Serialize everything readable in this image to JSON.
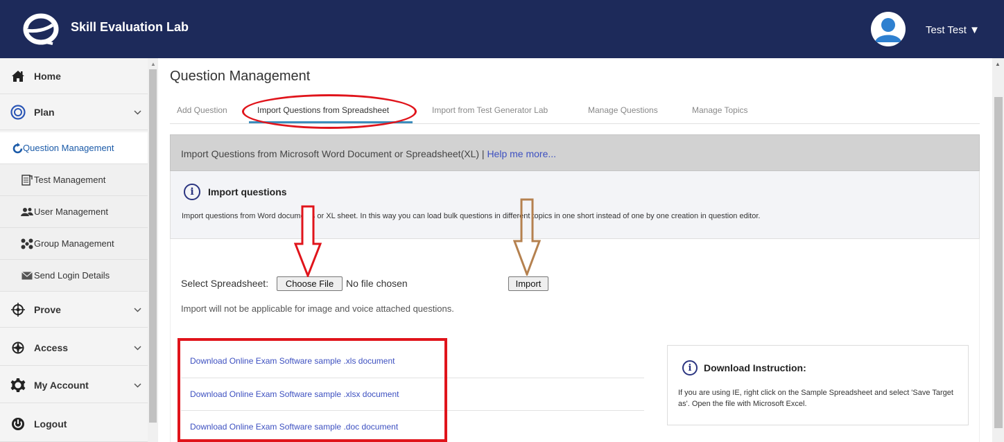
{
  "app": {
    "title": "Skill Evaluation Lab",
    "user_name": "Test Test ▼"
  },
  "sidebar": {
    "items": [
      {
        "label": "Home",
        "icon": "home-icon"
      },
      {
        "label": "Plan",
        "icon": "target-icon"
      },
      {
        "label": "Question Management",
        "icon": "refresh-icon"
      },
      {
        "label": "Test Management",
        "icon": "document-icon"
      },
      {
        "label": "User Management",
        "icon": "users-icon"
      },
      {
        "label": "Group Management",
        "icon": "group-icon"
      },
      {
        "label": "Send Login Details",
        "icon": "envelope-icon"
      },
      {
        "label": "Prove",
        "icon": "crosshair-icon"
      },
      {
        "label": "Access",
        "icon": "compass-icon"
      },
      {
        "label": "My Account",
        "icon": "gear-icon"
      },
      {
        "label": "Logout",
        "icon": "power-icon"
      }
    ]
  },
  "main": {
    "page_title": "Question Management",
    "tabs": [
      {
        "label": "Add Question"
      },
      {
        "label": "Import Questions from Spreadsheet"
      },
      {
        "label": "Import from Test Generator Lab"
      },
      {
        "label": "Manage Questions"
      },
      {
        "label": "Manage Topics"
      }
    ],
    "panel": {
      "heading": "Import Questions from Microsoft Word Document or Spreadsheet(XL) | ",
      "help_link": "Help me more..."
    },
    "info": {
      "title": "Import questions",
      "text": "Import questions from Word documents or XL sheet. In this way you can load bulk questions in different topics in one short instead of one by one creation in question editor."
    },
    "form": {
      "select_label": "Select Spreadsheet:",
      "choose_button": "Choose File",
      "file_status": "No file chosen",
      "import_button": "Import",
      "note": "Import will not be applicable for image and voice attached questions."
    },
    "downloads": [
      {
        "label": "Download Online Exam Software sample .xls document"
      },
      {
        "label": "Download Online Exam Software sample .xlsx document"
      },
      {
        "label": "Download Online Exam Software sample .doc document"
      }
    ],
    "instruction": {
      "title": "Download Instruction:",
      "text": "If you are using IE, right click on the Sample Spreadsheet and select 'Save Target as'. Open the file with Microsoft Excel."
    }
  },
  "colors": {
    "header": "#1d2a5a",
    "link": "#3d50c0",
    "annotation_red": "#e0141b",
    "annotation_brown": "#b5814f",
    "active_tab": "#3c8dbc"
  }
}
